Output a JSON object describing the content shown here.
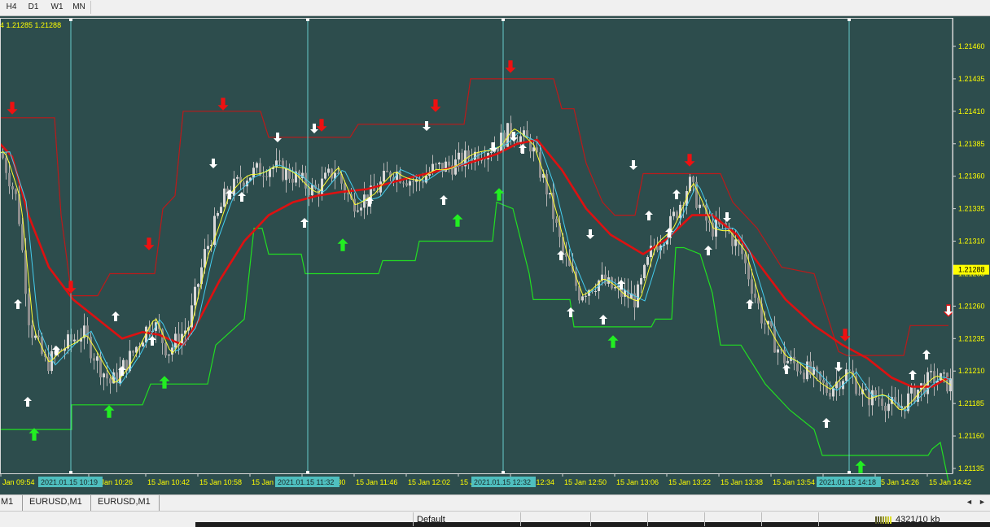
{
  "toolbar": {
    "timeframes": [
      "H4",
      "D1",
      "W1",
      "MN"
    ]
  },
  "chart": {
    "info_text": "4 1.21285 1.21288",
    "current_price_label": "1.21288",
    "price_levels": [
      "1.21460",
      "1.21435",
      "1.21410",
      "1.21385",
      "1.21360",
      "1.21335",
      "1.21310",
      "1.21285",
      "1.21260",
      "1.21235",
      "1.21210",
      "1.21185",
      "1.21160",
      "1.21135"
    ],
    "time_labels": [
      "Jan 09:54",
      "15 Jan 10:26",
      "15 Jan 10:42",
      "15 Jan 10:58",
      "15 Jan 11:14",
      "15 Jan 11:30",
      "15 Jan 11:46",
      "15 Jan 12:02",
      "15 Jan 12:18",
      "15 Jan 12:34",
      "15 Jan 12:50",
      "15 Jan 13:06",
      "15 Jan 13:22",
      "15 Jan 13:38",
      "15 Jan 13:54",
      "15 Jan 14:10",
      "15 Jan 14:26",
      "15 Jan 14:42"
    ],
    "time_markers": [
      "2021.01.15 10:19",
      "2021.01.15 11:32",
      "2021.01.15 12:32",
      "2021.01.15 14:18"
    ],
    "colors": {
      "background": "#2d4d4d",
      "candles": "#b4b4b4",
      "slow_ma": "#dd1111",
      "fast_ma": "#ffff33",
      "mid_ma": "#44ccee",
      "upper_channel": "#bb1a1a",
      "lower_channel": "#22dd22",
      "buy_arrow": "#22ee22",
      "sell_arrow": "#ee1111",
      "marker_line": "#66cccc",
      "scale_text": "#ffff00"
    }
  },
  "tabs": {
    "items": [
      "M1",
      "EURUSD,M1",
      "EURUSD,M1"
    ]
  },
  "status": {
    "profile": "Default",
    "traffic": "4321/10 kb"
  }
}
